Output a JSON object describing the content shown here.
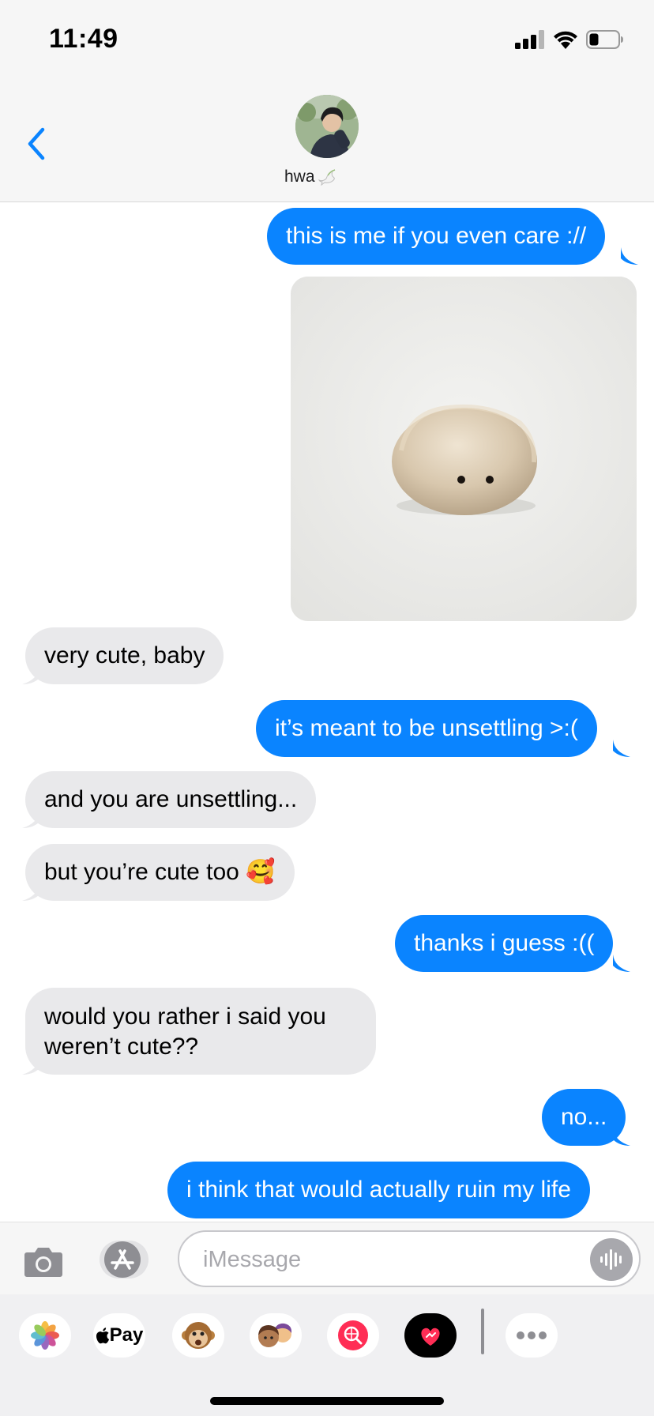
{
  "status_bar": {
    "time": "11:49"
  },
  "header": {
    "contact_name": "hwa"
  },
  "messages": [
    {
      "id": 1,
      "direction": "sent",
      "text": "this is me if you even care ://"
    },
    {
      "id": 2,
      "direction": "sent",
      "type": "image"
    },
    {
      "id": 3,
      "direction": "received",
      "text": "very cute, baby"
    },
    {
      "id": 4,
      "direction": "sent",
      "text": "it’s meant to be unsettling >:("
    },
    {
      "id": 5,
      "direction": "received",
      "text": "and you are unsettling..."
    },
    {
      "id": 6,
      "direction": "received",
      "text": "but you’re cute too 🥰"
    },
    {
      "id": 7,
      "direction": "sent",
      "text": "thanks i guess :(("
    },
    {
      "id": 8,
      "direction": "received",
      "lines": [
        "would you rather i said you",
        "weren’t cute??"
      ]
    },
    {
      "id": 9,
      "direction": "sent",
      "text": "no..."
    },
    {
      "id": 10,
      "direction": "sent",
      "text": "i think that would actually ruin my life"
    }
  ],
  "input": {
    "placeholder": "iMessage",
    "value": ""
  },
  "app_drawer": {
    "apple_pay_label": "Pay",
    "apps": [
      "photos-icon",
      "apple-pay-icon",
      "animoji-icon",
      "memoji-icon",
      "image-search-icon",
      "digital-touch-icon",
      "more-icon"
    ]
  },
  "colors": {
    "sent_bubble": "#0a84ff",
    "received_bubble": "#e9e9eb",
    "accent": "#0a84ff"
  }
}
